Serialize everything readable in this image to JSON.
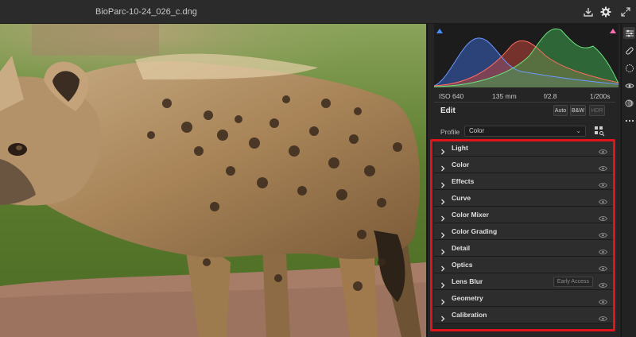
{
  "window": {
    "title": "BioParc-10-24_026_c.dng"
  },
  "photo": {
    "subject": "hyena-photo"
  },
  "histogram": {
    "exif": {
      "iso": "ISO 640",
      "focal_length": "135 mm",
      "aperture": "f/2.8",
      "shutter": "1/200s"
    }
  },
  "edit": {
    "title": "Edit",
    "auto_label": "Auto",
    "bw_label": "B&W",
    "hdr_label": "HDR"
  },
  "profile": {
    "label": "Profile",
    "value": "Color"
  },
  "sections": [
    {
      "label": "Light"
    },
    {
      "label": "Color"
    },
    {
      "label": "Effects"
    },
    {
      "label": "Curve"
    },
    {
      "label": "Color Mixer"
    },
    {
      "label": "Color Grading"
    },
    {
      "label": "Detail"
    },
    {
      "label": "Optics"
    },
    {
      "label": "Lens Blur",
      "badge": "Early Access"
    },
    {
      "label": "Geometry"
    },
    {
      "label": "Calibration"
    }
  ],
  "colors": {
    "highlight": "#e0141c",
    "panel_bg": "#252525",
    "section_bg": "#2d2d2d"
  }
}
